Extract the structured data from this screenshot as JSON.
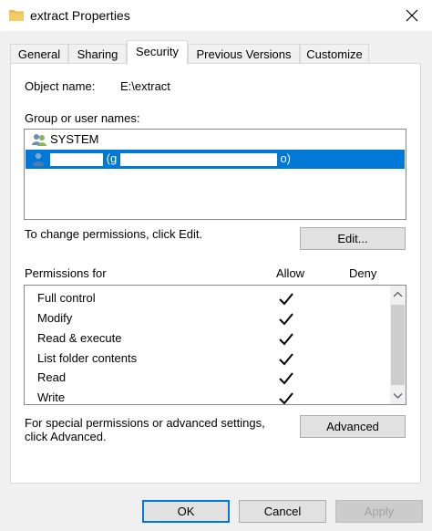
{
  "window": {
    "title": "extract Properties"
  },
  "tabs": [
    {
      "label": "General"
    },
    {
      "label": "Sharing"
    },
    {
      "label": "Security"
    },
    {
      "label": "Previous Versions"
    },
    {
      "label": "Customize"
    }
  ],
  "active_tab": "Security",
  "object": {
    "label": "Object name:",
    "value": "E:\\extract"
  },
  "groups": {
    "label": "Group or user names:",
    "items": [
      {
        "name": "SYSTEM",
        "icon": "group-users-icon"
      },
      {
        "name_prefix": "(g",
        "name_suffix": "o)",
        "icon": "user-icon",
        "selected": true
      }
    ]
  },
  "change_hint": "To change permissions, click Edit.",
  "edit_button": "Edit...",
  "permissions": {
    "label": "Permissions for",
    "allow_header": "Allow",
    "deny_header": "Deny",
    "rows": [
      {
        "name": "Full control",
        "allow": true,
        "deny": false
      },
      {
        "name": "Modify",
        "allow": true,
        "deny": false
      },
      {
        "name": "Read & execute",
        "allow": true,
        "deny": false
      },
      {
        "name": "List folder contents",
        "allow": true,
        "deny": false
      },
      {
        "name": "Read",
        "allow": true,
        "deny": false
      },
      {
        "name": "Write",
        "allow": true,
        "deny": false
      }
    ]
  },
  "advanced": {
    "hint_line1": "For special permissions or advanced settings,",
    "hint_line2": "click Advanced.",
    "button": "Advanced"
  },
  "footer": {
    "ok": "OK",
    "cancel": "Cancel",
    "apply": "Apply"
  },
  "colors": {
    "selection": "#0078d7",
    "folder": "#e8b84a"
  }
}
